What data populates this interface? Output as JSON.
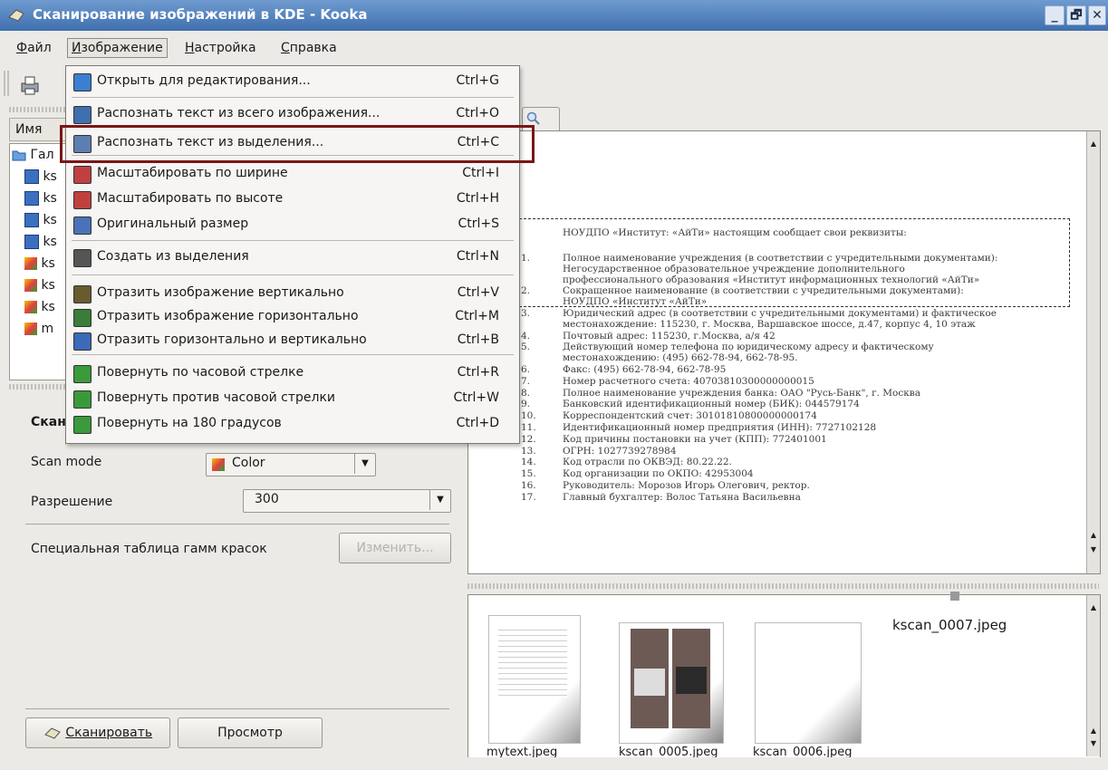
{
  "window": {
    "title": "Сканирование изображений в KDE - Kooka",
    "controls": [
      "_",
      "🗗",
      "✕"
    ]
  },
  "menubar": [
    {
      "label": "Файл",
      "u": "Ф",
      "rest": "айл"
    },
    {
      "label": "Изображение",
      "u": "И",
      "rest": "зображение"
    },
    {
      "label": "Настройка",
      "u": "Н",
      "rest": "астройка"
    },
    {
      "label": "Справка",
      "u": "С",
      "rest": "правка"
    }
  ],
  "dropdown": {
    "items": [
      {
        "label": "Открыть для редактирования...",
        "shortcut": "Ctrl+G",
        "icon": "open-edit-icon"
      },
      {
        "label": "Распознать текст из всего изображения...",
        "shortcut": "Ctrl+O",
        "icon": "ocr-image-icon"
      },
      {
        "label": "Распознать текст из выделения...",
        "shortcut": "Ctrl+C",
        "icon": "ocr-selection-icon"
      },
      {
        "label": "Масштабировать по ширине",
        "shortcut": "Ctrl+I",
        "icon": "scale-width-icon"
      },
      {
        "label": "Масштабировать по высоте",
        "shortcut": "Ctrl+H",
        "icon": "scale-height-icon"
      },
      {
        "label": "Оригинальный размер",
        "shortcut": "Ctrl+S",
        "icon": "original-size-icon"
      },
      {
        "label": "Создать из выделения",
        "shortcut": "Ctrl+N",
        "icon": "crop-icon"
      },
      {
        "label": "Отразить изображение вертикально",
        "shortcut": "Ctrl+V",
        "icon": "flip-vertical-icon"
      },
      {
        "label": "Отразить изображение горизонтально",
        "shortcut": "Ctrl+M",
        "icon": "flip-horizontal-icon"
      },
      {
        "label": "Отразить горизонтально и вертикально",
        "shortcut": "Ctrl+B",
        "icon": "flip-both-icon"
      },
      {
        "label": "Повернуть по часовой стрелке",
        "shortcut": "Ctrl+R",
        "icon": "rotate-cw-icon"
      },
      {
        "label": "Повернуть против часовой стрелки",
        "shortcut": "Ctrl+W",
        "icon": "rotate-ccw-icon"
      },
      {
        "label": "Повернуть на 180 градусов",
        "shortcut": "Ctrl+D",
        "icon": "rotate-180-icon"
      }
    ]
  },
  "left": {
    "column_header": "Имя",
    "tree_root": "Гал",
    "tree_items": [
      "ks",
      "ks",
      "ks",
      "ks",
      "ks",
      "ks",
      "ks",
      "m"
    ],
    "scan_heading": "Скан",
    "scan_mode_label": "Scan mode",
    "scan_mode_value": "Color",
    "resolution_label": "Разрешение",
    "resolution_value": "300",
    "gamma_label": "Специальная таблица гамм красок",
    "gamma_button": "Изменить...",
    "scan_button": "Сканировать",
    "preview_button": "Просмотр"
  },
  "document": {
    "header": "НОУДПО «Институт: «АйТи» настоящим сообщает свои реквизиты:",
    "items": [
      {
        "n": "1.",
        "lines": [
          "Полное наименование учреждения (в соответствии с учредительными документами):",
          "Негосударственное         образовательное          учреждение          дополнительного",
          "профессионального образования «Институт информационных технологий «АйТи»"
        ]
      },
      {
        "n": "2.",
        "lines": [
          "Сокращенное   наименование   (в   соответствии   с   учредительными   документами):",
          "НОУДПО «Институт «АйТи»"
        ]
      },
      {
        "n": "3.",
        "lines": [
          "Юридический адрес (в соответствии с учредительными документами) и фактическое",
          "местонахождение: 115230, г. Москва, Варшавское шоссе, д.47, корпус 4, 10 этаж"
        ]
      },
      {
        "n": "4.",
        "lines": [
          "Почтовый адрес: 115230, г.Москва, а/я 42"
        ]
      },
      {
        "n": "5.",
        "lines": [
          "Действующий   номер   телефона   по   юридическому   адресу   и   фактическому",
          "местонахождению: (495) 662-78-94, 662-78-95."
        ]
      },
      {
        "n": "6.",
        "lines": [
          "Факс: (495) 662-78-94, 662-78-95"
        ]
      },
      {
        "n": "7.",
        "lines": [
          "Номер расчетного счета: 40703810300000000015"
        ]
      },
      {
        "n": "8.",
        "lines": [
          "Полное наименование учреждения банка: ОАО \"Русь-Банк\", г. Москва"
        ]
      },
      {
        "n": "9.",
        "lines": [
          "Банковский идентификационный номер (БИК): 044579174"
        ]
      },
      {
        "n": "10.",
        "lines": [
          "Корреспондентский счет: 30101810800000000174"
        ]
      },
      {
        "n": "11.",
        "lines": [
          "Идентификационный номер предприятия (ИНН): 7727102128"
        ]
      },
      {
        "n": "12.",
        "lines": [
          "Код причины постановки на учет (КПП): 772401001"
        ]
      },
      {
        "n": "13.",
        "lines": [
          "ОГРН: 1027739278984"
        ]
      },
      {
        "n": "14.",
        "lines": [
          "Код отрасли по ОКВЭД: 80.22.22."
        ]
      },
      {
        "n": "15.",
        "lines": [
          "Код организации по ОКПО: 42953004"
        ]
      },
      {
        "n": "16.",
        "lines": [
          "Руководитель: Морозов Игорь Олегович, ректор."
        ]
      },
      {
        "n": "17.",
        "lines": [
          "Главный бухгалтер: Волос Татьяна Васильевна"
        ]
      }
    ]
  },
  "gallery": {
    "items": [
      "mytext.jpeg",
      "kscan_0005.jpeg",
      "kscan_0006.jpeg",
      "kscan_0007.jpeg"
    ]
  },
  "colors": {
    "highlight": "#7a1616",
    "titlebar": "#4f7fbf"
  }
}
